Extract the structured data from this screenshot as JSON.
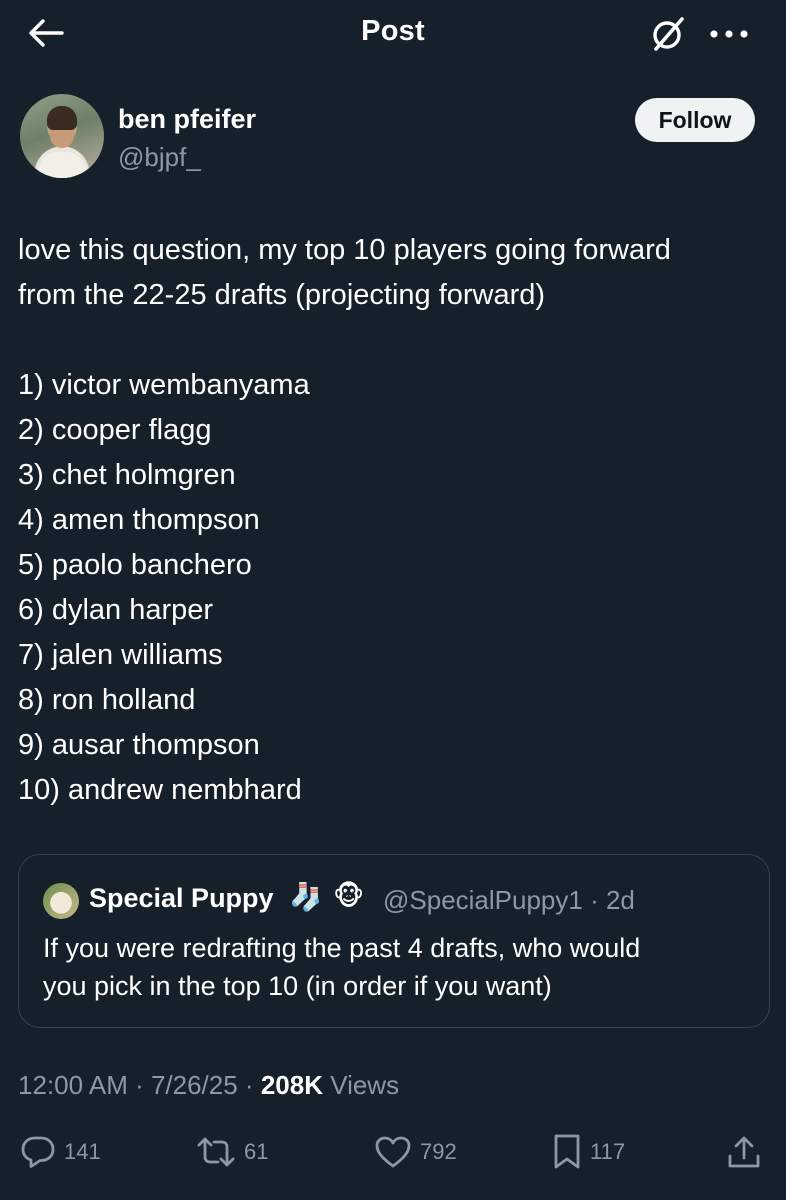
{
  "header": {
    "title": "Post",
    "back_icon": "arrow-left-icon",
    "grok_icon": "grok-slash-icon",
    "more_icon": "more-horizontal-icon"
  },
  "author": {
    "name": "ben pfeifer",
    "handle": "@bjpf_",
    "follow_label": "Follow"
  },
  "post": {
    "intro_lines": [
      "love this question, my top 10 players going forward",
      "from the 22-25 drafts (projecting forward)"
    ],
    "list": [
      "1) victor wembanyama",
      "2) cooper flagg",
      "3) chet holmgren",
      "4) amen thompson",
      "5) paolo banchero",
      "6) dylan harper",
      "7) jalen williams",
      "8) ron holland",
      "9) ausar thompson",
      "10) andrew nembhard"
    ]
  },
  "quote": {
    "name": "Special Puppy",
    "emoji1": "🧦",
    "emoji2": "🐵",
    "handle_time": "@SpecialPuppy1 · 2d",
    "text_lines": [
      "If you were redrafting the past 4 drafts, who would",
      "you pick in the top 10 (in order if you want)"
    ]
  },
  "meta": {
    "time": "12:00 AM · 7/26/25 · ",
    "views_count": "208K",
    "views_label": " Views"
  },
  "actions": {
    "replies": "141",
    "reposts": "61",
    "likes": "792",
    "bookmarks": "117"
  },
  "colors": {
    "background": "#15202b",
    "secondary_text": "#8b98a5",
    "border": "#38444d",
    "follow_bg": "#eff3f4"
  }
}
